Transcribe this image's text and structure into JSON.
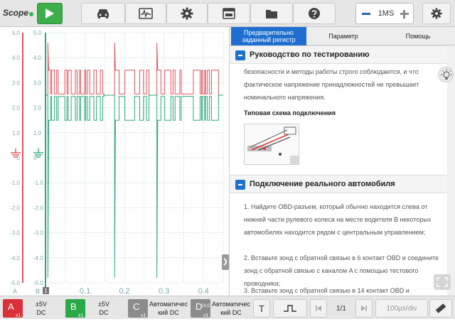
{
  "app": {
    "title": "Scope"
  },
  "timebase": {
    "value": "1MS"
  },
  "tabs": [
    {
      "label": "Предварительно заданный регистр"
    },
    {
      "label": "Параметр"
    },
    {
      "label": "Помощь"
    }
  ],
  "guide": {
    "heading": "Руководство по тестированию",
    "text": "безопасности и методы работы строго соблюдаются, и что фактическое напряжение принадлежностей не превышает номинального напряжения.",
    "diagram_title": "Типовая схема подключения"
  },
  "vehicle": {
    "heading": "Подключение реального автомобиля",
    "steps": [
      "1. Найдите OBD-разъем, который обычно находится слева от нижней части рулевого колеса на месте водителя В некоторых автомобилях находится рядом с центральным управлением;",
      "2. Вставьте зонд с обратной связью в 6 контакт OBD и соедините зонд с обратной связью с каналом A с помощью тестового проводника;",
      "3. Вставьте зонд с обратной связью в 14 контакт OBD и"
    ]
  },
  "scope": {
    "y_ticks_a": [
      "5.0",
      "4.0",
      "3.0",
      "2.0",
      "1.0",
      "0",
      "-1.0",
      "-2.0",
      "-3.0",
      "-4.0",
      "-5.0"
    ],
    "y_ticks_b": [
      "5.0",
      "4.0",
      "3.0",
      "2.0",
      "1.0",
      "0",
      "-1.0",
      "-2.0",
      "-3.0",
      "-4.0",
      "-5.0"
    ],
    "x_ticks": [
      "0.1",
      "0.2",
      "0.3",
      "0.4"
    ],
    "axis_a_label": "A",
    "axis_b_label": "B",
    "cursor_marker": "1",
    "channel_a_color": "#e0525a",
    "channel_b_color": "#2aa87a"
  },
  "channels": [
    {
      "letter": "A",
      "range": "±5V",
      "coupling": "DC",
      "color": "#d9303a",
      "mult": "x1"
    },
    {
      "letter": "B",
      "range": "±5V",
      "coupling": "DC",
      "color": "#2aa84a",
      "mult": "x1"
    },
    {
      "letter": "C",
      "range": "Автоматичес",
      "coupling": "кий DC",
      "color": "#8c8c8c",
      "mult": "x1"
    },
    {
      "letter": "D",
      "range": "Автоматичес",
      "coupling": "кий DC",
      "color": "#8c8c8c",
      "mult": "x1",
      "tag": "DLC"
    }
  ],
  "bottom": {
    "trigger_label": "T",
    "page": "1/1",
    "time_div": "100µs/div"
  }
}
